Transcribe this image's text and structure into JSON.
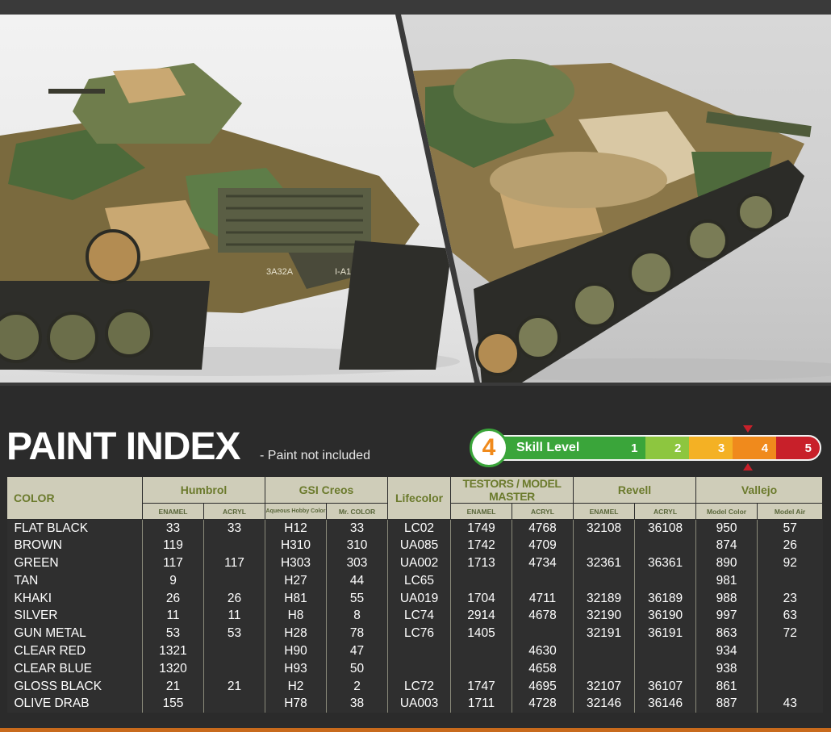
{
  "header": {
    "title": "PAINT INDEX",
    "note": "- Paint not included"
  },
  "photos": [
    {
      "decal_1": "3A32A",
      "decal_2": "I-A15"
    }
  ],
  "skill": {
    "current_level": "4",
    "label": "Skill Level",
    "levels": [
      "1",
      "2",
      "3",
      "4",
      "5"
    ],
    "level_colors": [
      "#3aa53a",
      "#8dc63f",
      "#f4b124",
      "#f08a1c",
      "#c8202a"
    ]
  },
  "table": {
    "color_header": "COLOR",
    "manufacturers": [
      {
        "name": "Humbrol",
        "sub": [
          "ENAMEL",
          "ACRYL"
        ]
      },
      {
        "name": "GSI Creos",
        "sub": [
          "Aqueous Hobby Color",
          "Mr. COLOR"
        ]
      },
      {
        "name": "Lifecolor",
        "sub": []
      },
      {
        "name": "TESTORS / MODEL MASTER",
        "sub": [
          "ENAMEL",
          "ACRYL"
        ]
      },
      {
        "name": "Revell",
        "sub": [
          "ENAMEL",
          "ACRYL"
        ]
      },
      {
        "name": "Vallejo",
        "sub": [
          "Model Color",
          "Model Air"
        ]
      }
    ],
    "rows": [
      [
        "FLAT BLACK",
        "33",
        "33",
        "H12",
        "33",
        "LC02",
        "1749",
        "4768",
        "32108",
        "36108",
        "950",
        "57"
      ],
      [
        "BROWN",
        "119",
        "",
        "H310",
        "310",
        "UA085",
        "1742",
        "4709",
        "",
        "",
        "874",
        "26"
      ],
      [
        "GREEN",
        "117",
        "117",
        "H303",
        "303",
        "UA002",
        "1713",
        "4734",
        "32361",
        "36361",
        "890",
        "92"
      ],
      [
        "TAN",
        "9",
        "",
        "H27",
        "44",
        "LC65",
        "",
        "",
        "",
        "",
        "981",
        ""
      ],
      [
        "KHAKI",
        "26",
        "26",
        "H81",
        "55",
        "UA019",
        "1704",
        "4711",
        "32189",
        "36189",
        "988",
        "23"
      ],
      [
        "SILVER",
        "11",
        "11",
        "H8",
        "8",
        "LC74",
        "2914",
        "4678",
        "32190",
        "36190",
        "997",
        "63"
      ],
      [
        "GUN METAL",
        "53",
        "53",
        "H28",
        "78",
        "LC76",
        "1405",
        "",
        "32191",
        "36191",
        "863",
        "72"
      ],
      [
        "CLEAR RED",
        "1321",
        "",
        "H90",
        "47",
        "",
        "",
        "4630",
        "",
        "",
        "934",
        ""
      ],
      [
        "CLEAR BLUE",
        "1320",
        "",
        "H93",
        "50",
        "",
        "",
        "4658",
        "",
        "",
        "938",
        ""
      ],
      [
        "GLOSS BLACK",
        "21",
        "21",
        "H2",
        "2",
        "LC72",
        "1747",
        "4695",
        "32107",
        "36107",
        "861",
        ""
      ],
      [
        "OLIVE DRAB",
        "155",
        "",
        "H78",
        "38",
        "UA003",
        "1711",
        "4728",
        "32146",
        "36146",
        "887",
        "43"
      ]
    ]
  }
}
